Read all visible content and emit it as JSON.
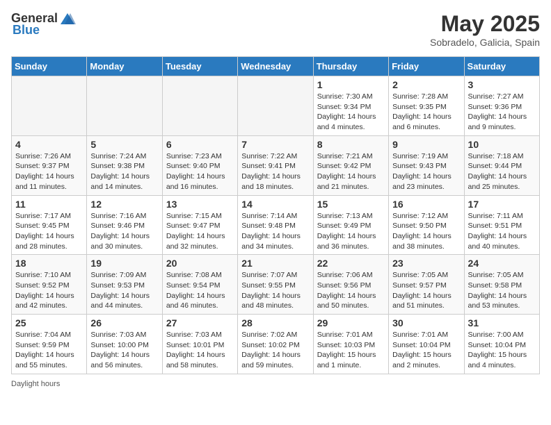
{
  "header": {
    "logo_general": "General",
    "logo_blue": "Blue",
    "month_title": "May 2025",
    "location": "Sobradelo, Galicia, Spain"
  },
  "days_of_week": [
    "Sunday",
    "Monday",
    "Tuesday",
    "Wednesday",
    "Thursday",
    "Friday",
    "Saturday"
  ],
  "weeks": [
    [
      {
        "day": "",
        "info": ""
      },
      {
        "day": "",
        "info": ""
      },
      {
        "day": "",
        "info": ""
      },
      {
        "day": "",
        "info": ""
      },
      {
        "day": "1",
        "info": "Sunrise: 7:30 AM\nSunset: 9:34 PM\nDaylight: 14 hours\nand 4 minutes."
      },
      {
        "day": "2",
        "info": "Sunrise: 7:28 AM\nSunset: 9:35 PM\nDaylight: 14 hours\nand 6 minutes."
      },
      {
        "day": "3",
        "info": "Sunrise: 7:27 AM\nSunset: 9:36 PM\nDaylight: 14 hours\nand 9 minutes."
      }
    ],
    [
      {
        "day": "4",
        "info": "Sunrise: 7:26 AM\nSunset: 9:37 PM\nDaylight: 14 hours\nand 11 minutes."
      },
      {
        "day": "5",
        "info": "Sunrise: 7:24 AM\nSunset: 9:38 PM\nDaylight: 14 hours\nand 14 minutes."
      },
      {
        "day": "6",
        "info": "Sunrise: 7:23 AM\nSunset: 9:40 PM\nDaylight: 14 hours\nand 16 minutes."
      },
      {
        "day": "7",
        "info": "Sunrise: 7:22 AM\nSunset: 9:41 PM\nDaylight: 14 hours\nand 18 minutes."
      },
      {
        "day": "8",
        "info": "Sunrise: 7:21 AM\nSunset: 9:42 PM\nDaylight: 14 hours\nand 21 minutes."
      },
      {
        "day": "9",
        "info": "Sunrise: 7:19 AM\nSunset: 9:43 PM\nDaylight: 14 hours\nand 23 minutes."
      },
      {
        "day": "10",
        "info": "Sunrise: 7:18 AM\nSunset: 9:44 PM\nDaylight: 14 hours\nand 25 minutes."
      }
    ],
    [
      {
        "day": "11",
        "info": "Sunrise: 7:17 AM\nSunset: 9:45 PM\nDaylight: 14 hours\nand 28 minutes."
      },
      {
        "day": "12",
        "info": "Sunrise: 7:16 AM\nSunset: 9:46 PM\nDaylight: 14 hours\nand 30 minutes."
      },
      {
        "day": "13",
        "info": "Sunrise: 7:15 AM\nSunset: 9:47 PM\nDaylight: 14 hours\nand 32 minutes."
      },
      {
        "day": "14",
        "info": "Sunrise: 7:14 AM\nSunset: 9:48 PM\nDaylight: 14 hours\nand 34 minutes."
      },
      {
        "day": "15",
        "info": "Sunrise: 7:13 AM\nSunset: 9:49 PM\nDaylight: 14 hours\nand 36 minutes."
      },
      {
        "day": "16",
        "info": "Sunrise: 7:12 AM\nSunset: 9:50 PM\nDaylight: 14 hours\nand 38 minutes."
      },
      {
        "day": "17",
        "info": "Sunrise: 7:11 AM\nSunset: 9:51 PM\nDaylight: 14 hours\nand 40 minutes."
      }
    ],
    [
      {
        "day": "18",
        "info": "Sunrise: 7:10 AM\nSunset: 9:52 PM\nDaylight: 14 hours\nand 42 minutes."
      },
      {
        "day": "19",
        "info": "Sunrise: 7:09 AM\nSunset: 9:53 PM\nDaylight: 14 hours\nand 44 minutes."
      },
      {
        "day": "20",
        "info": "Sunrise: 7:08 AM\nSunset: 9:54 PM\nDaylight: 14 hours\nand 46 minutes."
      },
      {
        "day": "21",
        "info": "Sunrise: 7:07 AM\nSunset: 9:55 PM\nDaylight: 14 hours\nand 48 minutes."
      },
      {
        "day": "22",
        "info": "Sunrise: 7:06 AM\nSunset: 9:56 PM\nDaylight: 14 hours\nand 50 minutes."
      },
      {
        "day": "23",
        "info": "Sunrise: 7:05 AM\nSunset: 9:57 PM\nDaylight: 14 hours\nand 51 minutes."
      },
      {
        "day": "24",
        "info": "Sunrise: 7:05 AM\nSunset: 9:58 PM\nDaylight: 14 hours\nand 53 minutes."
      }
    ],
    [
      {
        "day": "25",
        "info": "Sunrise: 7:04 AM\nSunset: 9:59 PM\nDaylight: 14 hours\nand 55 minutes."
      },
      {
        "day": "26",
        "info": "Sunrise: 7:03 AM\nSunset: 10:00 PM\nDaylight: 14 hours\nand 56 minutes."
      },
      {
        "day": "27",
        "info": "Sunrise: 7:03 AM\nSunset: 10:01 PM\nDaylight: 14 hours\nand 58 minutes."
      },
      {
        "day": "28",
        "info": "Sunrise: 7:02 AM\nSunset: 10:02 PM\nDaylight: 14 hours\nand 59 minutes."
      },
      {
        "day": "29",
        "info": "Sunrise: 7:01 AM\nSunset: 10:03 PM\nDaylight: 15 hours\nand 1 minute."
      },
      {
        "day": "30",
        "info": "Sunrise: 7:01 AM\nSunset: 10:04 PM\nDaylight: 15 hours\nand 2 minutes."
      },
      {
        "day": "31",
        "info": "Sunrise: 7:00 AM\nSunset: 10:04 PM\nDaylight: 15 hours\nand 4 minutes."
      }
    ]
  ],
  "footer": {
    "daylight_label": "Daylight hours"
  }
}
